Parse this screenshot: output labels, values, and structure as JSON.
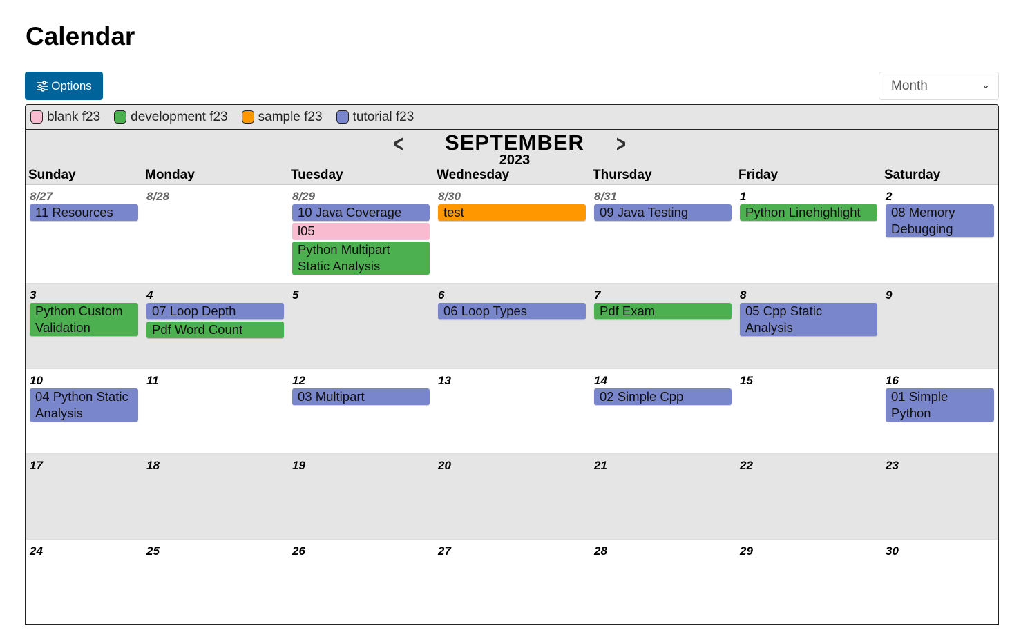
{
  "title": "Calendar",
  "options_label": "Options",
  "view_select": "Month",
  "legend": [
    {
      "label": "blank f23",
      "color": "#f8bbd0"
    },
    {
      "label": "development f23",
      "color": "#4caf50"
    },
    {
      "label": "sample f23",
      "color": "#ff9800"
    },
    {
      "label": "tutorial f23",
      "color": "#7986cb"
    }
  ],
  "nav": {
    "month": "SEPTEMBER",
    "year": "2023",
    "prev_icon": "chevron-left-icon",
    "next_icon": "chevron-right-icon"
  },
  "weekdays": [
    "Sunday",
    "Monday",
    "Tuesday",
    "Wednesday",
    "Thursday",
    "Friday",
    "Saturday"
  ],
  "weeks": [
    {
      "days": [
        {
          "date": "8/27",
          "prev": true,
          "events": [
            {
              "title": "11 Resources",
              "cal": 3
            }
          ]
        },
        {
          "date": "8/28",
          "prev": true,
          "events": []
        },
        {
          "date": "8/29",
          "prev": true,
          "events": [
            {
              "title": "10 Java Coverage",
              "cal": 3
            },
            {
              "title": "l05",
              "cal": 0
            },
            {
              "title": "Python Multipart Static Analysis",
              "cal": 1
            }
          ]
        },
        {
          "date": "8/30",
          "prev": true,
          "events": [
            {
              "title": "test",
              "cal": 2
            }
          ]
        },
        {
          "date": "8/31",
          "prev": true,
          "events": [
            {
              "title": "09 Java Testing",
              "cal": 3
            }
          ]
        },
        {
          "date": "1",
          "events": [
            {
              "title": "Python Linehighlight",
              "cal": 1
            }
          ]
        },
        {
          "date": "2",
          "events": [
            {
              "title": "08 Memory Debugging",
              "cal": 3
            }
          ]
        }
      ]
    },
    {
      "days": [
        {
          "date": "3",
          "events": [
            {
              "title": "Python Custom Validation",
              "cal": 1
            }
          ]
        },
        {
          "date": "4",
          "events": [
            {
              "title": "07 Loop Depth",
              "cal": 3
            },
            {
              "title": "Pdf Word Count",
              "cal": 1
            }
          ]
        },
        {
          "date": "5",
          "events": []
        },
        {
          "date": "6",
          "events": [
            {
              "title": "06 Loop Types",
              "cal": 3
            }
          ]
        },
        {
          "date": "7",
          "events": [
            {
              "title": "Pdf Exam",
              "cal": 1
            }
          ]
        },
        {
          "date": "8",
          "events": [
            {
              "title": "05 Cpp Static Analysis",
              "cal": 3
            }
          ]
        },
        {
          "date": "9",
          "events": []
        }
      ]
    },
    {
      "days": [
        {
          "date": "10",
          "events": [
            {
              "title": "04 Python Static Analysis",
              "cal": 3
            }
          ]
        },
        {
          "date": "11",
          "events": []
        },
        {
          "date": "12",
          "events": [
            {
              "title": "03 Multipart",
              "cal": 3
            }
          ]
        },
        {
          "date": "13",
          "events": []
        },
        {
          "date": "14",
          "events": [
            {
              "title": "02 Simple Cpp",
              "cal": 3
            }
          ]
        },
        {
          "date": "15",
          "events": []
        },
        {
          "date": "16",
          "events": [
            {
              "title": "01 Simple Python",
              "cal": 3
            }
          ]
        }
      ]
    },
    {
      "days": [
        {
          "date": "17",
          "events": []
        },
        {
          "date": "18",
          "events": []
        },
        {
          "date": "19",
          "events": []
        },
        {
          "date": "20",
          "events": []
        },
        {
          "date": "21",
          "events": []
        },
        {
          "date": "22",
          "events": []
        },
        {
          "date": "23",
          "events": []
        }
      ]
    },
    {
      "days": [
        {
          "date": "24",
          "events": []
        },
        {
          "date": "25",
          "events": []
        },
        {
          "date": "26",
          "events": []
        },
        {
          "date": "27",
          "events": []
        },
        {
          "date": "28",
          "events": []
        },
        {
          "date": "29",
          "events": []
        },
        {
          "date": "30",
          "events": []
        }
      ]
    }
  ]
}
